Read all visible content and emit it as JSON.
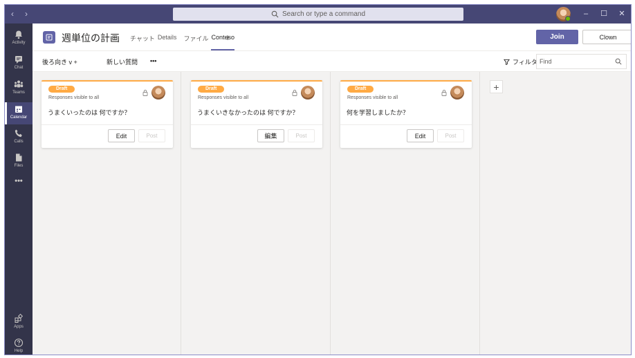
{
  "titlebar": {
    "back": "‹",
    "forward": "›",
    "search_placeholder": "Search or type a command",
    "minimize": "–",
    "maximize": "☐",
    "close": "✕"
  },
  "rail": [
    {
      "label": "Activity",
      "icon": "bell-icon"
    },
    {
      "label": "Chat",
      "icon": "chat-icon"
    },
    {
      "label": "Teams",
      "icon": "teams-icon"
    },
    {
      "label": "Calendar",
      "icon": "calendar-icon",
      "active": true
    },
    {
      "label": "Calls",
      "icon": "phone-icon"
    },
    {
      "label": "Files",
      "icon": "file-icon"
    },
    {
      "label": "•••",
      "icon": "more-icon"
    },
    {
      "label": "Apps",
      "icon": "apps-icon"
    },
    {
      "label": "Help",
      "icon": "help-icon"
    }
  ],
  "header": {
    "title": "週単位の計画",
    "tabs": [
      "チャット",
      "Details",
      "ファイル",
      "Contoso"
    ],
    "active_tab": "Contoso",
    "add_tab": "+",
    "join_label": "Join",
    "close_label": "Clown"
  },
  "toolbar": {
    "sort_label": "後ろ向き v +",
    "new_question": "新しい質問",
    "more": "•••",
    "filter_label": "フィルター",
    "find_placeholder": "Find"
  },
  "columns": [
    {
      "badge": "Draft",
      "visibility": "Responses visible to all",
      "question": "うまくいったのは 何ですか？",
      "edit_label": "Edit",
      "post_label": "Post"
    },
    {
      "badge": "Draft",
      "visibility": "Responses visible to all",
      "question": "うまくいきなかったのは 何ですか？",
      "edit_label": "編集",
      "post_label": "Post"
    },
    {
      "badge": "Draft",
      "visibility": "Responses visible to all",
      "question": "何を学習しましたか？",
      "edit_label": "Edit",
      "post_label": "Post"
    }
  ],
  "add_column": "+",
  "colors": {
    "rail": "#33344a",
    "titlebar": "#464775",
    "accent": "#6264a7",
    "draft": "#ffaa44"
  }
}
